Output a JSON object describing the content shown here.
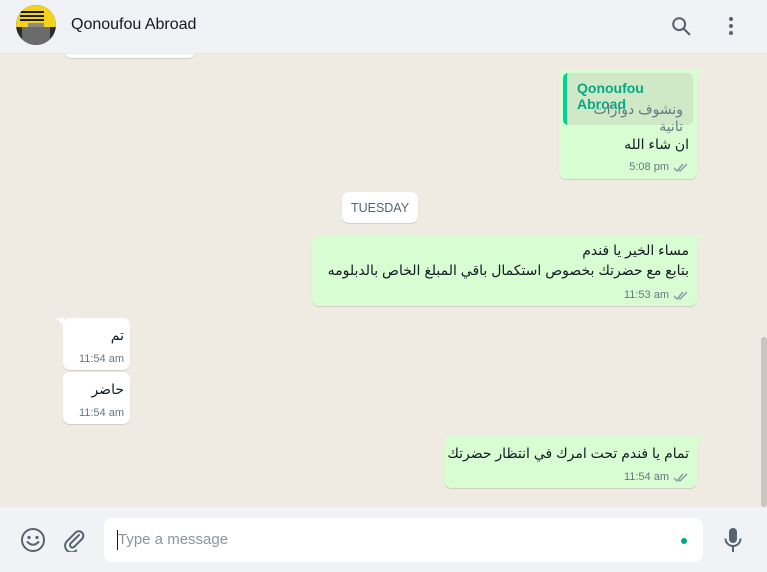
{
  "header": {
    "contact_name": "Qonoufou Abroad"
  },
  "icons": {
    "search": "search-icon",
    "menu": "kebab-menu-icon",
    "emoji": "emoji-icon",
    "attach": "paperclip-icon",
    "mic": "microphone-icon",
    "read": "double-check-icon"
  },
  "colors": {
    "outgoing_bubble": "#d9fdd3",
    "incoming_bubble": "#ffffff",
    "accent": "#06cf9c",
    "chat_background": "#efeae2"
  },
  "chat": {
    "day_separator": "TUESDAY",
    "messages": [
      {
        "direction": "out",
        "quote": {
          "author": "Qonoufou Abroad",
          "text": "ونشوف دوارات تانية"
        },
        "text": "ان شاء الله",
        "time": "5:08 pm"
      },
      {
        "direction": "out",
        "line1": "مساء الخير يا فندم",
        "line2": "بتابع مع حضرتك بخصوص استكمال باقي المبلغ الخاص بالدبلومه",
        "time": "11:53 am"
      },
      {
        "direction": "in",
        "text": "تم",
        "time": "11:54 am"
      },
      {
        "direction": "in",
        "text": "حاضر",
        "time": "11:54 am"
      },
      {
        "direction": "out",
        "text": "تمام يا فندم تحت امرك في انتظار حضرتك",
        "time": "11:54 am"
      }
    ]
  },
  "composer": {
    "placeholder": "Type a message"
  }
}
